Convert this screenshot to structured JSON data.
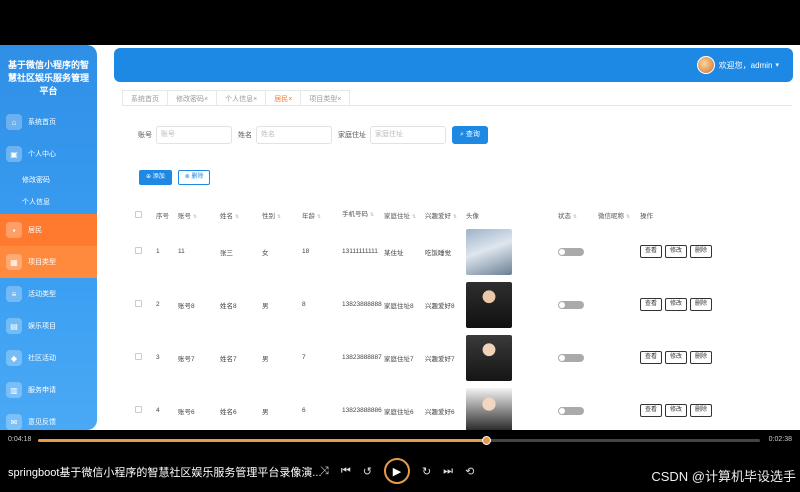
{
  "sidebar": {
    "title": "基于微信小程序的智慧社区娱乐服务管理平台",
    "items": [
      {
        "label": "系统首页",
        "icon": "home-icon"
      },
      {
        "label": "个人中心",
        "icon": "user-center-icon"
      },
      {
        "label": "修改密码",
        "sub": true
      },
      {
        "label": "个人信息",
        "sub": true
      },
      {
        "label": "居民",
        "icon": "resident-icon"
      },
      {
        "label": "项目类型",
        "icon": "grid-icon"
      },
      {
        "label": "活动类型",
        "icon": "list-icon"
      },
      {
        "label": "娱乐项目",
        "icon": "project-icon"
      },
      {
        "label": "社区活动",
        "icon": "activity-icon"
      },
      {
        "label": "服务申请",
        "icon": "apply-icon"
      },
      {
        "label": "意见反馈",
        "icon": "feedback-icon"
      }
    ]
  },
  "header": {
    "welcome": "欢迎您，admin",
    "caret": "▾"
  },
  "tabs": [
    {
      "label": "系统首页",
      "close": ""
    },
    {
      "label": "修改密码",
      "close": "×"
    },
    {
      "label": "个人信息",
      "close": "×"
    },
    {
      "label": "居民",
      "close": "×",
      "active": true
    },
    {
      "label": "项目类型",
      "close": "×"
    }
  ],
  "search": {
    "account_label": "账号",
    "account_placeholder": "账号",
    "name_label": "姓名",
    "name_placeholder": "姓名",
    "address_label": "家庭住址",
    "address_placeholder": "家庭住址",
    "button": "查询"
  },
  "actions": {
    "add": "添加",
    "delete": "删除"
  },
  "table": {
    "headers": [
      "序号",
      "账号",
      "姓名",
      "性别",
      "年龄",
      "手机号码",
      "家庭住址",
      "兴趣爱好",
      "头像",
      "状态",
      "微信昵称",
      "操作"
    ],
    "rows": [
      {
        "idx": "1",
        "account": "11",
        "name": "张三",
        "sex": "女",
        "age": "18",
        "phone": "13111111111",
        "address": "某住址",
        "hobby": "吃饭睡觉",
        "photo": "young-man"
      },
      {
        "idx": "2",
        "account": "账号8",
        "name": "姓名8",
        "sex": "男",
        "age": "8",
        "phone": "13823888888",
        "address": "家庭住址8",
        "hobby": "兴趣爱好8",
        "photo": "man-suit"
      },
      {
        "idx": "3",
        "account": "账号7",
        "name": "姓名7",
        "sex": "男",
        "age": "7",
        "phone": "13823888887",
        "address": "家庭住址7",
        "hobby": "兴趣爱好7",
        "photo": "woman-suit"
      },
      {
        "idx": "4",
        "account": "账号6",
        "name": "姓名6",
        "sex": "男",
        "age": "6",
        "phone": "13823888886",
        "address": "家庭住址6",
        "hobby": "兴趣爱好6",
        "photo": "woman-smile"
      }
    ],
    "op_view": "查看",
    "op_edit": "修改",
    "op_delete": "删除"
  },
  "player": {
    "elapsed": "0:04:18",
    "total": "0:02:38",
    "progress": 0.62,
    "title": "springboot基于微信小程序的智慧社区娱乐服务管理平台录像演...",
    "watermark": "CSDN @计算机毕设选手",
    "accent": "#e89b4c"
  }
}
